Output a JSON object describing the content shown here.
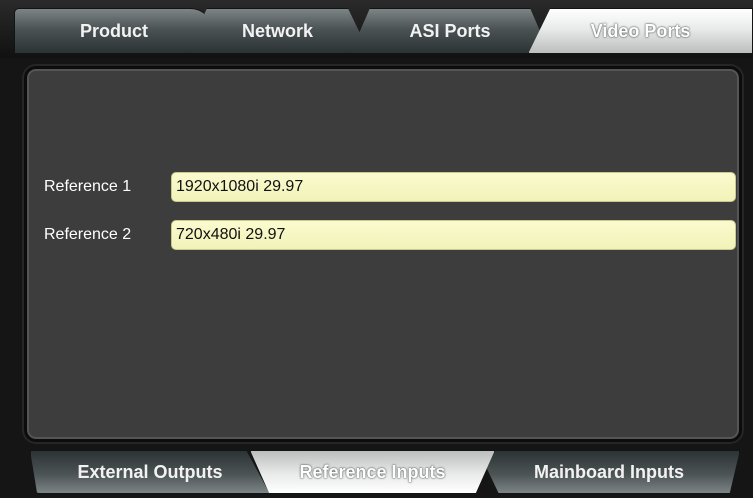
{
  "top_tabs": [
    {
      "label": "Product"
    },
    {
      "label": "Network"
    },
    {
      "label": "ASI Ports"
    },
    {
      "label": "Video Ports",
      "selected": true
    }
  ],
  "reference_panel": {
    "fields": [
      {
        "label": "Reference 1",
        "value": "1920x1080i 29.97"
      },
      {
        "label": "Reference 2",
        "value": "720x480i 29.97"
      }
    ]
  },
  "bottom_tabs": [
    {
      "label": "External Outputs"
    },
    {
      "label": "Reference Inputs",
      "selected": true
    },
    {
      "label": "Mainboard Inputs"
    }
  ],
  "colors": {
    "field_background": "#f7f7c4",
    "panel_background": "#3d3d3d",
    "tab_active": "#e9eaea",
    "tab_inactive": "#4b5355"
  }
}
